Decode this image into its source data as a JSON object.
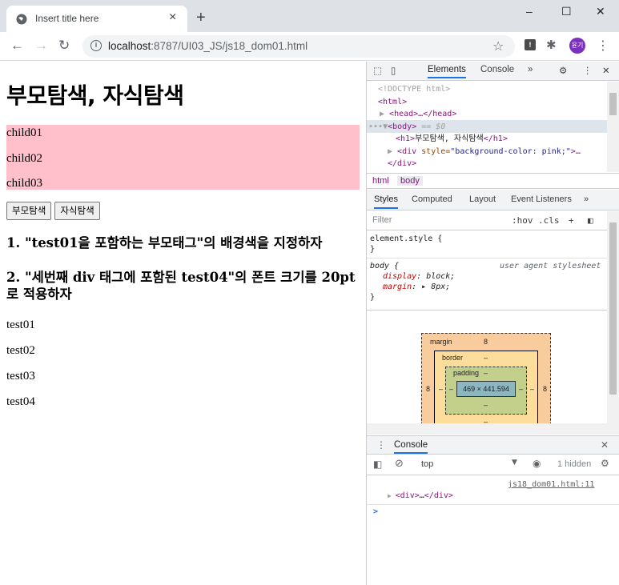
{
  "browser": {
    "tab_title": "Insert title here",
    "tab_close": "×",
    "new_tab": "+",
    "url_host": "localhost",
    "url_path": ":8787/UI03_JS/js18_dom01.html",
    "avatar_text": "윤기",
    "window_controls": [
      "–",
      "☐",
      "✕"
    ]
  },
  "page": {
    "heading": "부모탐색, 자식탐색",
    "children": [
      "child01",
      "child02",
      "child03"
    ],
    "pink_color": "#ffc0cb",
    "buttons": [
      "부모탐색",
      "자식탐색"
    ],
    "task1": "1. \"test01을 포함하는 부모태그\"의 배경색을 지정하자",
    "task2_line1": "2. \"세번째 div 태그에 포함된 test04\"의 폰트 크기를 20pt",
    "task2_line2": "로 적용하자",
    "tests": [
      "test01",
      "test02",
      "test03",
      "test04"
    ]
  },
  "devtools": {
    "tabs": {
      "elements": "Elements",
      "console": "Console",
      "more": "»"
    },
    "dom": {
      "doctype": "<!DOCTYPE html>",
      "html_open": "<html>",
      "head": "<head>…</head>",
      "body_prefix": "•••",
      "body_tag": "<body>",
      "body_eq": "== $0",
      "h1_open": "<h1>",
      "h1_text": "부모탐색, 자식탐색",
      "h1_close": "</h1>",
      "div_open": "<div ",
      "div_attr": "style=",
      "div_val": "\"background-color: pink;\"",
      "div_tail": ">…",
      "div_close": "</div>"
    },
    "breadcrumbs": [
      "html",
      "body"
    ],
    "style_tabs": [
      "Styles",
      "Computed",
      "Layout",
      "Event Listeners",
      "»"
    ],
    "filter_placeholder": "Filter",
    "filter_opts": [
      ":hov",
      ".cls",
      "+"
    ],
    "rules": {
      "element_style": "element.style {",
      "close": "}",
      "body_sel": "body {",
      "ua": "user agent stylesheet",
      "display_prop": "display",
      "display_val": "block;",
      "margin_prop": "margin",
      "margin_val": "▸ 8px;"
    },
    "boxmodel": {
      "margin_label": "margin",
      "margin_val": "8",
      "border_label": "border",
      "border_val": "–",
      "padding_label": "padding",
      "padding_val": "–",
      "content": "469 × 441.594",
      "left_margin": "8",
      "right_margin": "8",
      "left_border": "–",
      "right_border": "–",
      "left_padding": "–",
      "right_padding": "–",
      "bottom_padding": "–",
      "bottom_border": "–"
    },
    "console": {
      "title": "Console",
      "context": "top",
      "hidden": "1 hidden",
      "source": "js18_dom01.html:11",
      "log_open": "<div>",
      "log_mid": "…",
      "log_close": "</div>",
      "prompt": ">"
    }
  }
}
